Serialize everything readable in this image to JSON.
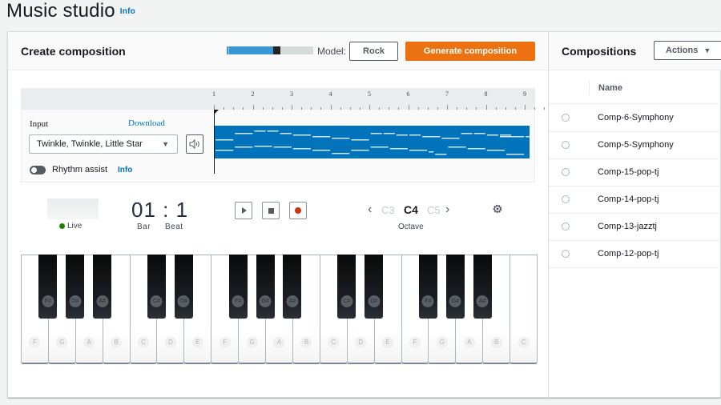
{
  "page": {
    "title": "Music studio",
    "info_label": "Info"
  },
  "create": {
    "title": "Create composition",
    "progress_fraction": 0.54,
    "model_label": "Model:",
    "model_value": "Rock",
    "generate_label": "Generate composition",
    "input_label": "Input",
    "download_label": "Download",
    "input_value": "Twinkle, Twinkle, Little Star",
    "rhythm_assist_label": "Rhythm assist",
    "rhythm_assist_on": false,
    "rhythm_info_label": "Info",
    "ruler_numbers": [
      "1",
      "2",
      "3",
      "4",
      "5",
      "6",
      "7",
      "8",
      "9"
    ]
  },
  "transport": {
    "live_label": "Live",
    "time_display": "01 : 1",
    "bar_label": "Bar",
    "beat_label": "Beat",
    "octave_prev": "C3",
    "octave_current": "C4",
    "octave_next": "C5",
    "octave_label": "Octave",
    "icons": [
      "play-icon",
      "stop-icon",
      "record-icon",
      "gear-icon"
    ]
  },
  "piano": {
    "white_keys": [
      "F",
      "G",
      "A",
      "B",
      "C",
      "D",
      "E",
      "F",
      "G",
      "A",
      "B",
      "C",
      "D",
      "E",
      "F",
      "G",
      "A",
      "B",
      "C"
    ],
    "black_keys": [
      {
        "label": "F#",
        "after_white": 0
      },
      {
        "label": "G#",
        "after_white": 1
      },
      {
        "label": "A#",
        "after_white": 2
      },
      {
        "label": "C#",
        "after_white": 4
      },
      {
        "label": "D#",
        "after_white": 5
      },
      {
        "label": "F#",
        "after_white": 7
      },
      {
        "label": "G#",
        "after_white": 8
      },
      {
        "label": "A#",
        "after_white": 9
      },
      {
        "label": "C#",
        "after_white": 11
      },
      {
        "label": "D#",
        "after_white": 12
      },
      {
        "label": "F#",
        "after_white": 14
      },
      {
        "label": "G#",
        "after_white": 15
      },
      {
        "label": "A#",
        "after_white": 16
      }
    ]
  },
  "compositions": {
    "title": "Compositions",
    "actions_label": "Actions",
    "column_name": "Name",
    "rows": [
      {
        "name": "Comp-6-Symphony"
      },
      {
        "name": "Comp-5-Symphony"
      },
      {
        "name": "Comp-15-pop-tj"
      },
      {
        "name": "Comp-14-pop-tj"
      },
      {
        "name": "Comp-13-jazztj"
      },
      {
        "name": "Comp-12-pop-tj"
      }
    ]
  }
}
